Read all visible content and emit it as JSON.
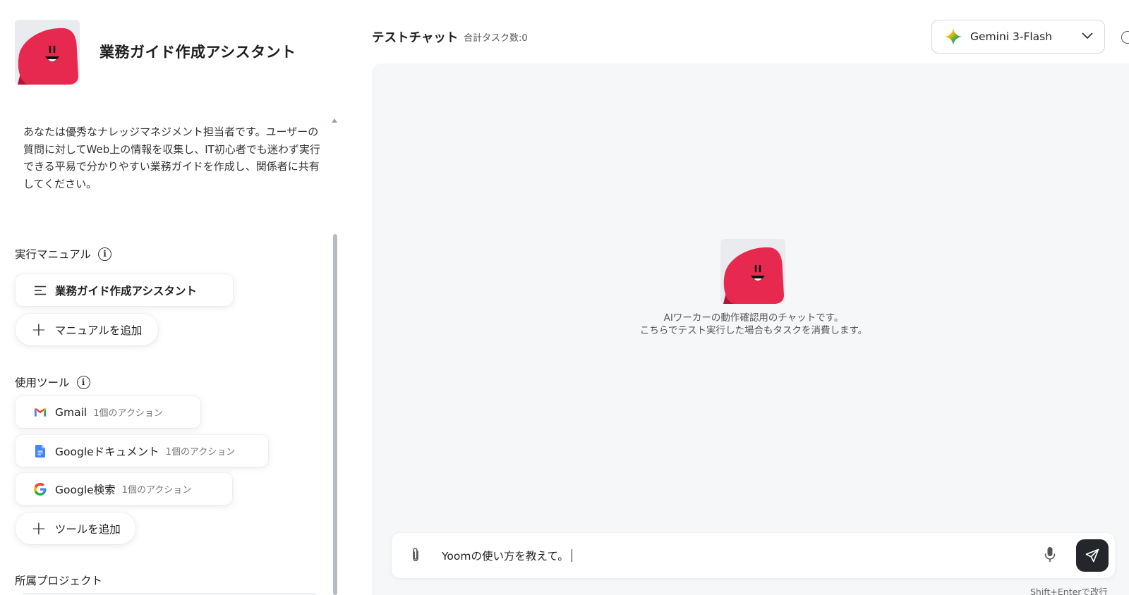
{
  "agent": {
    "title": "業務ガイド作成アシスタント",
    "prompt": "あなたは優秀なナレッジマネジメント担当者です。ユーザーの質問に対してWeb上の情報を収集し、IT初心者でも迷わず実行できる平易で分かりやすい業務ガイドを作成し、関係者に共有してください。"
  },
  "manuals": {
    "label": "実行マニュアル",
    "items": [
      {
        "label": "業務ガイド作成アシスタント",
        "icon": "list-icon"
      }
    ],
    "add_label": "マニュアルを追加"
  },
  "tools": {
    "label": "使用ツール",
    "items": [
      {
        "name": "Gmail",
        "actions": "1個のアクション",
        "icon": "gmail-icon"
      },
      {
        "name": "Googleドキュメント",
        "actions": "1個のアクション",
        "icon": "google-docs-icon"
      },
      {
        "name": "Google検索",
        "actions": "1個のアクション",
        "icon": "google-icon"
      }
    ],
    "add_label": "ツールを追加"
  },
  "project": {
    "label": "所属プロジェクト"
  },
  "chat": {
    "title": "テストチャット",
    "task_count": "合計タスク数:0",
    "model": "Gemini 3-Flash",
    "notice_line1": "AIワーカーの動作確認用のチャットです。",
    "notice_line2": "こちらでテスト実行した場合もタスクを消費します。",
    "input_value": "Yoomの使い方を教えて。",
    "hint": "Shift+Enterで改行"
  },
  "colors": {
    "brand_red": "#e8294f",
    "dark_red": "#b3143a",
    "send_bg": "#23272b",
    "chat_bg": "#f6f7f8"
  }
}
